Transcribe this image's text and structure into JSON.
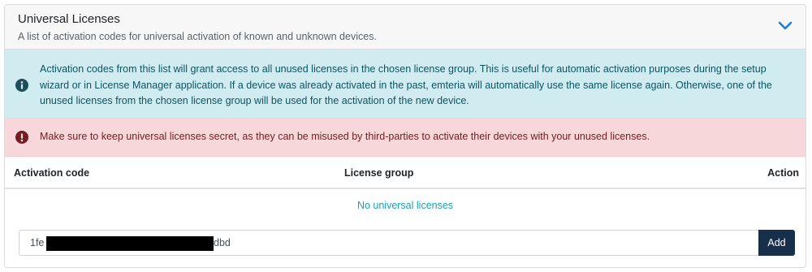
{
  "header": {
    "title": "Universal Licenses",
    "subtitle": "A list of activation codes for universal activation of known and unknown devices.",
    "toggle_icon": "chevron-down-icon"
  },
  "alerts": {
    "info": {
      "icon": "info-circle-icon",
      "text": "Activation codes from this list will grant access to all unused licenses in the chosen license group. This is useful for automatic activation purposes during the setup wizard or in License Manager application. If a device was already activated in the past, emteria will automatically use the same license again. Otherwise, one of the unused licenses from the chosen license group will be used for the activation of the new device.",
      "color": "#0c5460",
      "background": "#d1ecf1"
    },
    "danger": {
      "icon": "exclamation-circle-icon",
      "text": "Make sure to keep universal licenses secret, as they can be misused by third-parties to activate their devices with your unused licenses.",
      "color": "#721c24",
      "background": "#f8d7da"
    }
  },
  "table": {
    "columns": [
      "Activation code",
      "License group",
      "Action"
    ],
    "empty_text": "No universal licenses"
  },
  "add_form": {
    "input_value_start": "1fe",
    "input_value_end": "dbd",
    "add_label": "Add",
    "button_color": "#172f4a"
  }
}
